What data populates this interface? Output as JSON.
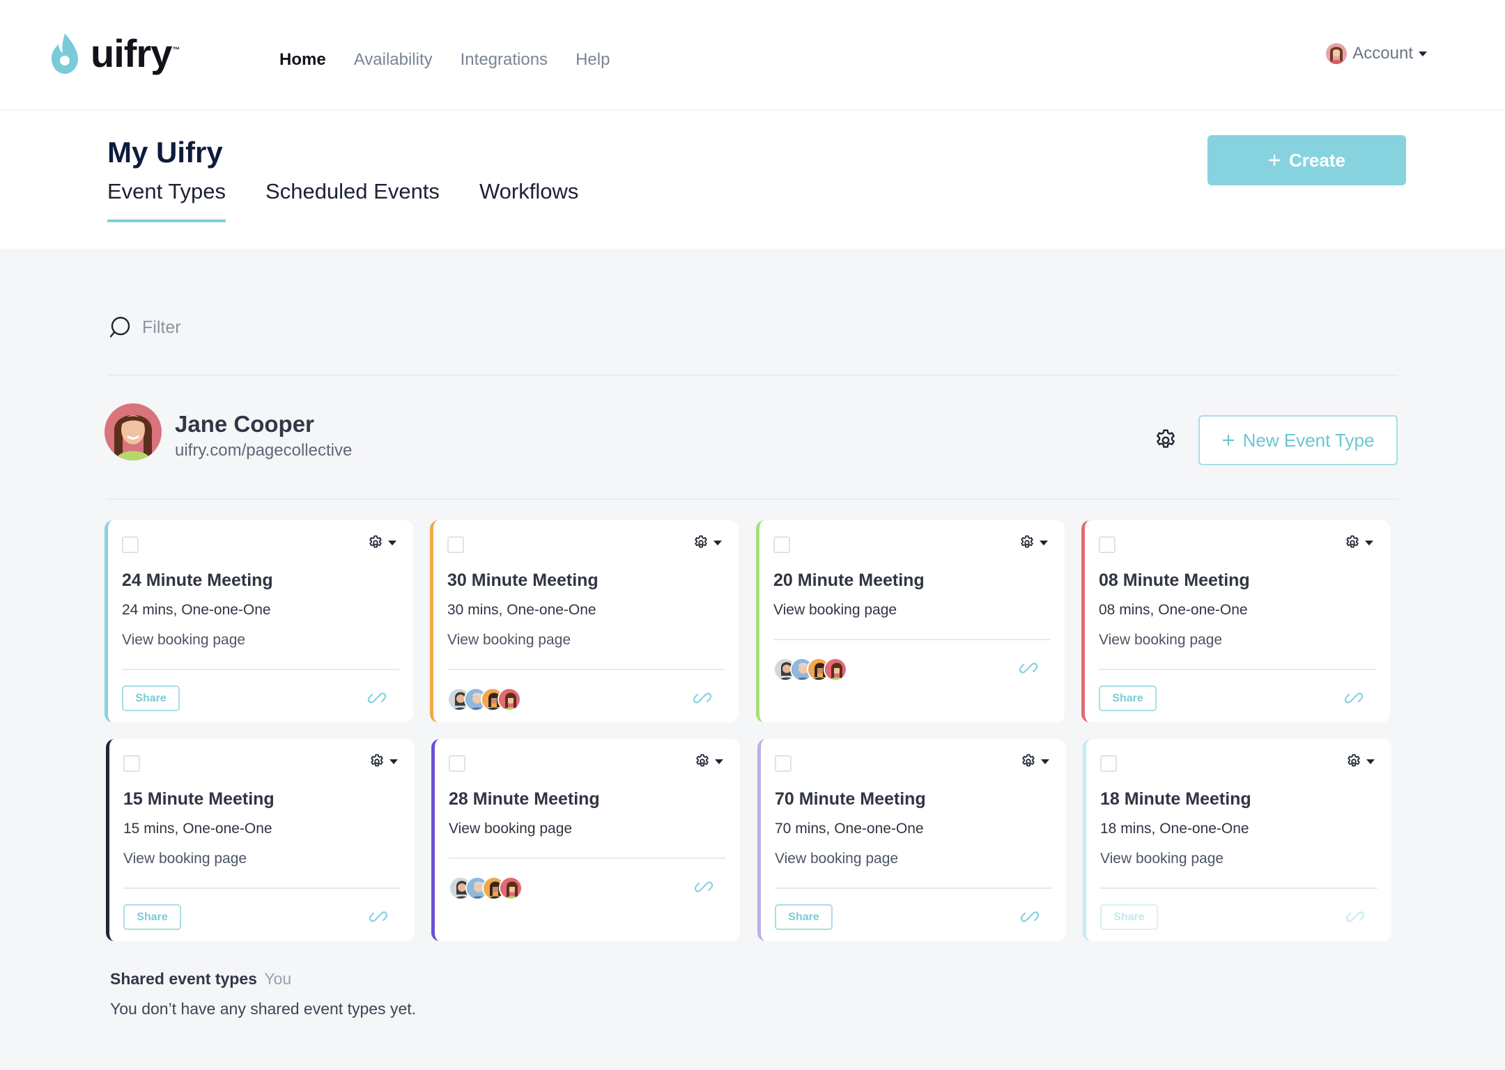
{
  "brand": {
    "name": "uifry",
    "tm": "™",
    "accent": "#86d3df"
  },
  "nav": {
    "items": [
      "Home",
      "Availability",
      "Integrations",
      "Help"
    ],
    "active": "Home"
  },
  "account": {
    "label": "Account"
  },
  "header": {
    "title": "My Uifry",
    "tabs": [
      "Event Types",
      "Scheduled Events",
      "Workflows"
    ],
    "active_tab": "Event Types",
    "create_label": "Create"
  },
  "filter": {
    "placeholder": "Filter"
  },
  "user": {
    "name": "Jane Cooper",
    "url": "uifry.com/pagecollective",
    "new_event_label": "New Event Type"
  },
  "events": [
    {
      "title": "24 Minute Meeting",
      "details": "24 mins, One-one-One",
      "link": "View booking page",
      "share": "Share",
      "color": "#86d3df"
    },
    {
      "title": "30 Minute Meeting",
      "details": "30 mins, One-one-One",
      "link": "View booking page",
      "color": "#f0a94a"
    },
    {
      "title": "20 Minute Meeting",
      "details": "",
      "link": "View booking page",
      "color": "#a7e07b"
    },
    {
      "title": "08 Minute Meeting",
      "details": "08 mins, One-one-One",
      "link": "View booking page",
      "share": "Share",
      "color": "#e36a73"
    },
    {
      "title": "15 Minute Meeting",
      "details": "15 mins, One-one-One",
      "link": "View booking page",
      "share": "Share",
      "color": "#1f2533"
    },
    {
      "title": "28 Minute Meeting",
      "details": "",
      "link": "View booking page",
      "color": "#6c4fd6"
    },
    {
      "title": "70 Minute Meeting",
      "details": "70 mins, One-one-One",
      "link": "View booking page",
      "share": "Share",
      "color": "#b9b2ea"
    },
    {
      "title": "18 Minute Meeting",
      "details": "18 mins, One-one-One",
      "link": "View booking page",
      "share": "Share",
      "color": "#c7ecf2"
    }
  ],
  "shared": {
    "title": "Shared event types",
    "owner": "You",
    "empty": "You don’t have any shared event types yet."
  },
  "icons": [
    "search-icon",
    "gear-icon",
    "plus-icon",
    "link-icon",
    "chevron-down-icon",
    "checkbox-icon"
  ]
}
